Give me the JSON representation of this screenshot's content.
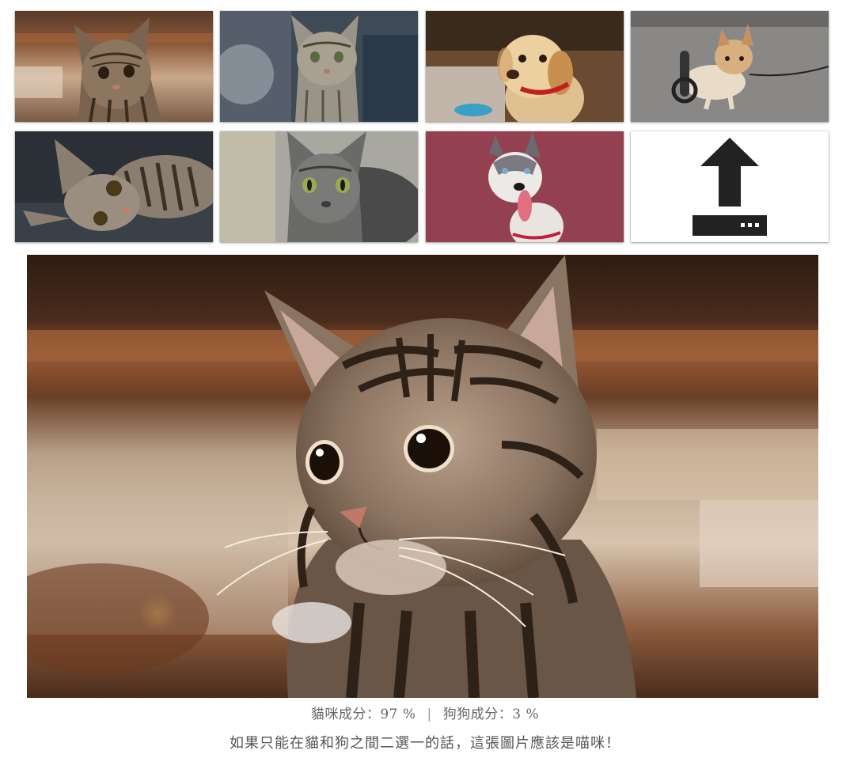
{
  "gallery": {
    "thumbnails": [
      {
        "subject": "cat",
        "icon": "tabby-kitten-photo"
      },
      {
        "subject": "cat",
        "icon": "gray-tabby-cat-photo"
      },
      {
        "subject": "dog",
        "icon": "golden-puppy-photo"
      },
      {
        "subject": "dog",
        "icon": "corgi-wheelchair-photo"
      },
      {
        "subject": "cat",
        "icon": "lying-tabby-cat-photo"
      },
      {
        "subject": "cat",
        "icon": "green-eyed-cat-photo"
      },
      {
        "subject": "dog",
        "icon": "husky-photo"
      }
    ],
    "upload_icon": "upload-icon"
  },
  "result": {
    "cat_label": "貓咪成分：",
    "cat_value": "97 %",
    "separator": "|",
    "dog_label": "狗狗成分：",
    "dog_value": "3 %",
    "verdict": "如果只能在貓和狗之間二選一的話，這張圖片應該是喵咪！"
  },
  "colors": {
    "text": "#555555",
    "upload_icon": "#222222"
  }
}
